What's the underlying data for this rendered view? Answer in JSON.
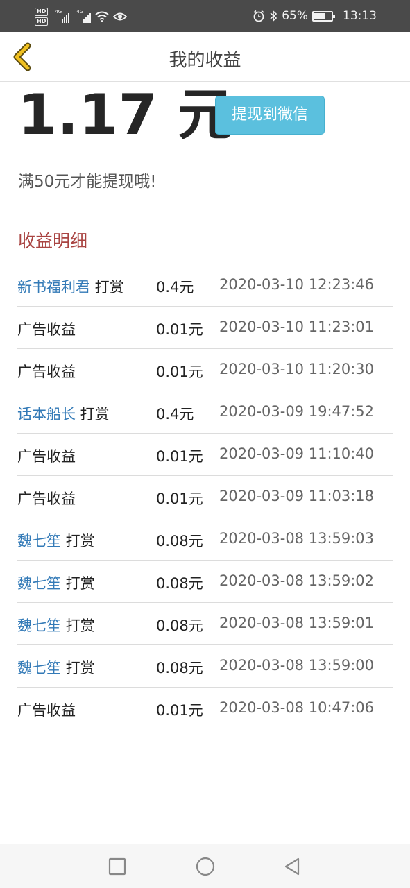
{
  "status_bar": {
    "hd1": "HD",
    "hd2": "HD",
    "net1": "4G",
    "net2": "4G",
    "battery_percent": "65%",
    "battery_level": 0.65,
    "time": "13:13"
  },
  "header": {
    "title": "我的收益"
  },
  "balance": {
    "amount": "1.17 元",
    "withdraw_label": "提现到微信",
    "tip": "满50元才能提现哦!"
  },
  "section_title": "收益明细",
  "records": [
    {
      "user": "新书福利君",
      "suffix": " 打赏",
      "label": "",
      "value": "0.4元",
      "time": "2020-03-10 12:23:46"
    },
    {
      "user": "",
      "suffix": "",
      "label": "广告收益",
      "value": "0.01元",
      "time": "2020-03-10 11:23:01"
    },
    {
      "user": "",
      "suffix": "",
      "label": "广告收益",
      "value": "0.01元",
      "time": "2020-03-10 11:20:30"
    },
    {
      "user": "话本船长",
      "suffix": " 打赏",
      "label": "",
      "value": "0.4元",
      "time": "2020-03-09 19:47:52"
    },
    {
      "user": "",
      "suffix": "",
      "label": "广告收益",
      "value": "0.01元",
      "time": "2020-03-09 11:10:40"
    },
    {
      "user": "",
      "suffix": "",
      "label": "广告收益",
      "value": "0.01元",
      "time": "2020-03-09 11:03:18"
    },
    {
      "user": "魏七笙",
      "suffix": " 打赏",
      "label": "",
      "value": "0.08元",
      "time": "2020-03-08 13:59:03"
    },
    {
      "user": "魏七笙",
      "suffix": " 打赏",
      "label": "",
      "value": "0.08元",
      "time": "2020-03-08 13:59:02"
    },
    {
      "user": "魏七笙",
      "suffix": " 打赏",
      "label": "",
      "value": "0.08元",
      "time": "2020-03-08 13:59:01"
    },
    {
      "user": "魏七笙",
      "suffix": " 打赏",
      "label": "",
      "value": "0.08元",
      "time": "2020-03-08 13:59:00"
    },
    {
      "user": "",
      "suffix": "",
      "label": "广告收益",
      "value": "0.01元",
      "time": "2020-03-08 10:47:06"
    }
  ],
  "colors": {
    "accent_button": "#5bc0de",
    "link_blue": "#337ab7",
    "section_title": "#a94442",
    "back_arrow": "#f0c020"
  }
}
